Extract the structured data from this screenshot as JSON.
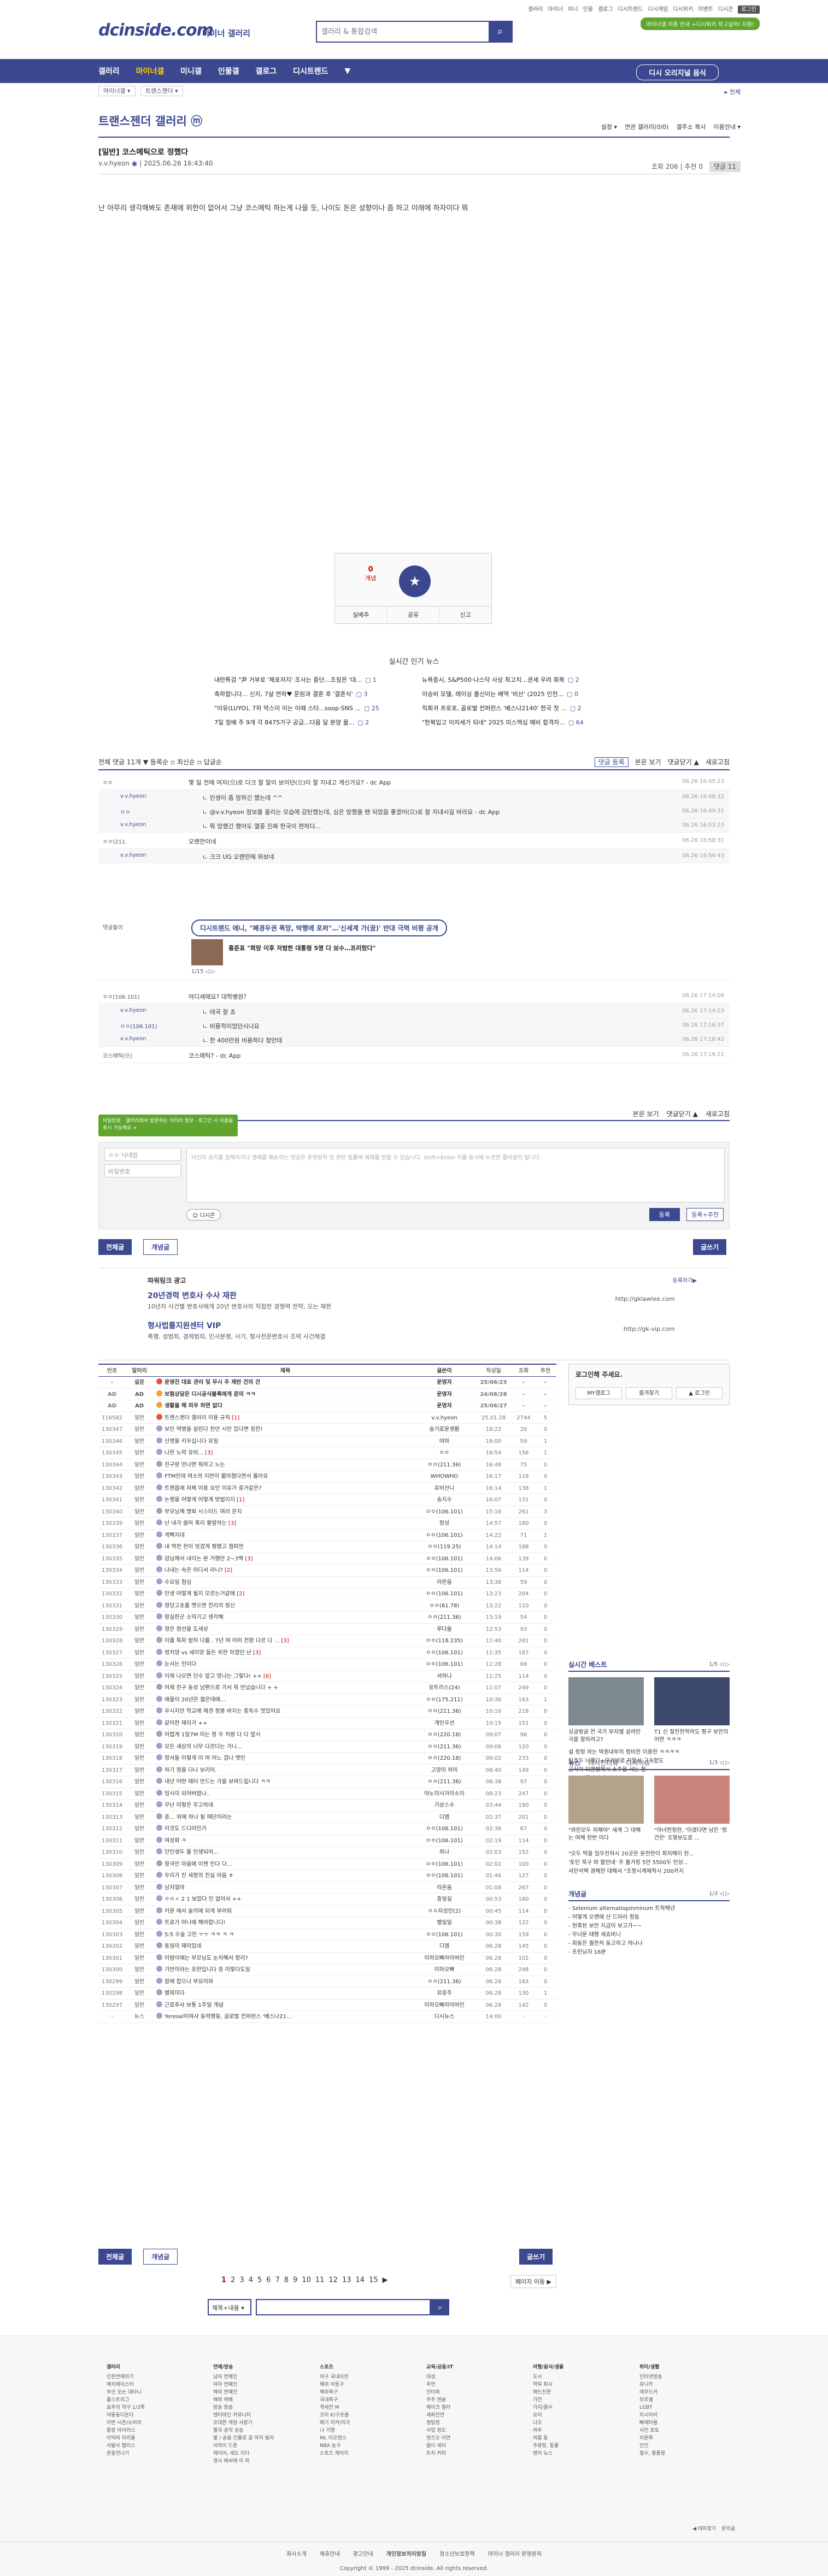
{
  "header": {
    "logo": "dcinside.com",
    "logo_sub": "마이너 갤러리",
    "search_placeholder": "갤러리 & 통합검색",
    "top_links": [
      "갤러리",
      "마이너",
      "미니",
      "인물",
      "갤로그",
      "디시트렌드",
      "디시게임",
      "디시위키",
      "이벤트",
      "디시콘",
      "로그인"
    ],
    "green_btn": "마이너갤 이용 안내 +디시위키 하고싶어! 지원!"
  },
  "nav": {
    "items": [
      "갤러리",
      "마이너갤",
      "미니갤",
      "인물갤",
      "갤로그",
      "디시트렌드",
      "▼"
    ],
    "active": 1,
    "right_button": "디시 오리지널 음식"
  },
  "breadcrumb": {
    "left": [
      "마이너갤 ▾",
      "트랜스젠더 ▾"
    ],
    "right": "▸ 전체"
  },
  "gallery": {
    "title": "트랜스젠더 갤러리 ⓜ",
    "tools": [
      "설정 ▾",
      "연관 갤러리(0/0)",
      "갤주소 복사",
      "이용안내 ▾"
    ]
  },
  "post": {
    "title": "[일반] 코스메틱으로 정했다",
    "author": "v.v.hyeon",
    "date": "2025.06.26 16:43:40",
    "views_label": "조회 206",
    "recs_label": "추천 0",
    "comments_label": "댓글 11",
    "body": "난 아무리 생각해봐도 존재에 위한이 없어서 그냥 코스메틱 하는게 나을 듯, 나이도 돈은 성향이나 좀 하고 이래에 하자이다 뭐"
  },
  "recommend": {
    "up_count": "0",
    "up_label": "개념",
    "buttons": [
      "실베추",
      "공유",
      "신고"
    ]
  },
  "news": {
    "title": "실시간 인기 뉴스",
    "rows": [
      [
        {
          "t": "내란특검 \"尹 거부로 '체포저지' 조사는 중단…조징은 '대...",
          "c": "1"
        },
        {
          "t": "뉴욕증시, S&P500·나스닥 사상 최고치…관세 우려 회복",
          "c": "2"
        }
      ],
      [
        {
          "t": "축하합니다... 신지, 7살 연하♥ 문원과 결혼 후 '결혼식'",
          "c": "3"
        },
        {
          "t": "이승비 모델, 레이싱 출신이는 배역 '비산' (2025 인천...",
          "c": "0"
        }
      ],
      [
        {
          "t": "\"이유(LUYO), 7위 막스이 이는 이때 스타...soop·SNS ...",
          "c": "25"
        },
        {
          "t": "직회귀 프로포, 골로벌 컨퍼런스 '베스나2140' 한국 첫 ...",
          "c": "2"
        }
      ],
      [
        {
          "t": "7일 정배 주 9개 각 8475가구 공급...다음 달 분양 물...",
          "c": "2"
        },
        {
          "t": "\"한복입고 이자세가 되네\" 2025 미스맥심 예비 합격자...",
          "c": "64"
        }
      ]
    ]
  },
  "comments": {
    "head_left": "전체 댓글 11개 ▼ 등록순 ▫ 최신순 ▫ 답글순",
    "head_right": [
      "댓글 등록",
      "본문 보기",
      "댓글닫기 ▲",
      "새로고침"
    ],
    "items": [
      {
        "nick": "ㅇㅇ",
        "text": "몇 일 전에 여자(으)로 다크 할 말이 보이던(으)이 할 지내고 계신가요? - dc App",
        "date": "06.26 16:45:23",
        "reply": false
      },
      {
        "nick": "v.v.hyeon",
        "text": "ㄴ 인생이 좀 망하긴 했는데 ^^",
        "date": "06.26 16:48:32",
        "reply": true
      },
      {
        "nick": "ㅇㅇ",
        "text": "ㄴ @v.v.hyeon 정보를 올리는 모습에 감탄했는데, 심은 망했을 땐 되었음 좋겠어(으)로 잘 지내시길 바라요 - dc App",
        "date": "06.26 16:49:31",
        "reply": true
      },
      {
        "nick": "v.v.hyeon",
        "text": "ㄴ 뭐 망했긴 했어도 열중 진짜 한국이 편하다...",
        "date": "06.26 16:53:23",
        "reply": true
      },
      {
        "nick": "ㅇㅇ(211.",
        "text": "오렌만이네",
        "date": "06.26 16:58:31",
        "reply": false
      },
      {
        "nick": "v.v.hyeon",
        "text": "ㄴ 크크 UG 오렌만에 와보네",
        "date": "06.26 16:59:43",
        "reply": true
      }
    ],
    "items2": [
      {
        "nick": "ㅇㅇ(106.101)",
        "text": "아디세에요? 대학병원?",
        "date": "06.26 17:14:06",
        "reply": false
      },
      {
        "nick": "v.v.hyeon",
        "text": "ㄴ 테국 잘 쵸",
        "date": "06.26 17:14:23",
        "reply": true
      },
      {
        "nick": "ㅇㅇ(106.101)",
        "text": "ㄴ 비용적이었던시나요",
        "date": "06.26 17:16:37",
        "reply": true
      },
      {
        "nick": "v.v.hyeon",
        "text": "ㄴ 한 400만원 비용하다 정안데",
        "date": "06.26 17:18:42",
        "reply": true
      },
      {
        "nick": "코스메틱(으)",
        "text": "코스메틱? - dc App",
        "date": "06.26 17:19:21",
        "reply": false
      }
    ],
    "ad": {
      "label": "댓글돌이",
      "pill": "디시트렌드 에니, \"폐경우권 폭망, 박행에 포퍼\"…'신세계 가(꿈)' 반대 극력 비평 공개",
      "text": "홍준표 \"희망 이후 저범한 대통령 5명 다 보수…프리랐다\"",
      "pager": "1/15 ◁ ▷"
    }
  },
  "write": {
    "right": [
      "본문 보기",
      "댓글닫기 ▲",
      "새로고침"
    ],
    "tooltip": "비밀번호 · 갤러리에서 방문하는 이터러 정보 · 로그인 시 이름을 표시 가능해요 ×",
    "nick_placeholder": "ㅇㅇ 닉네임",
    "pw_placeholder": "비밀번호",
    "textarea_placeholder": "타인의 권리를 침해하거나 명예를 훼손하는 댓글은 운영원칙 및 관련 법률에 제재를 받을 수 있습니다. Shift+Enter 키를 동시에 누르면 줄바꿈이 됩니다.",
    "dccon": "디시콘",
    "submit": "등록",
    "submit2": "등록+추천"
  },
  "buttons": {
    "all": "전체글",
    "best": "개념글",
    "write": "글쓰기"
  },
  "promo": {
    "head": "파워링크 광고",
    "right": "등록하기▶",
    "t1": "20년경력 변호사 수사 재판",
    "t1s": "10년차 사건별 변호사에게 20년 변호사의 직접한 경쟁력 전략, 오는 재판",
    "u1": "http://gklawlee.com",
    "t2": "형사법률지원센터 VIP",
    "t2s": "폭행, 성범죄, 경제범죄, 민사분쟁, 사기, 형사전문변호사 조력 사건해결",
    "u2": "http://gk-vip.com"
  },
  "board": {
    "headers": [
      "번호",
      "말머리",
      "제목",
      "글쓴이",
      "작성일",
      "조회",
      "추천"
    ],
    "rows": [
      [
        "-",
        "설문",
        "운영진 대표 관리 및 무시 주 제반 건의 건",
        "",
        "운영자",
        "25/06/23",
        "-",
        "-"
      ],
      [
        "AD",
        "AD",
        "보험상담은 디시공식블록에게 문의 ㅋㅋ",
        "",
        "운영자",
        "24/08/28",
        "-",
        "-"
      ],
      [
        "AD",
        "AD",
        "생활을 해 피우 하면 없다",
        "",
        "운영자",
        "25/06/27",
        "-",
        "-"
      ],
      [
        "116582",
        "일반",
        "트랜스젠더 갤러리 이용 규칙",
        "1",
        "v.v.hyeon",
        "25.01.28",
        "2744",
        "5"
      ],
      [
        "130347",
        "일반",
        "보인 역병을 살린다 천만 시인 있다면 칭찬!",
        "",
        "슬기로운생활",
        "18:22",
        "20",
        "0"
      ],
      [
        "130346",
        "일반",
        "신명을 키우십니다 유일",
        "",
        "여하",
        "18:00",
        "59",
        "1"
      ],
      [
        "130345",
        "일반",
        "나한 노력 유비...",
        "3",
        "ㅇㅇ",
        "16:54",
        "156",
        "1"
      ],
      [
        "130344",
        "일반",
        "친구랑 만나면 뭐하고 노는",
        "",
        "ㅇㅇ(211.36)",
        "16:48",
        "75",
        "0"
      ],
      [
        "130343",
        "일반",
        "FTM인데 여소의 지반이 짧아졌다면서 몰라요",
        "",
        "WHOWHO",
        "16:17",
        "119",
        "0"
      ],
      [
        "130342",
        "일반",
        "트랜옵에 자체 이용 요인 이유가 중거같은?",
        "",
        "유비산니",
        "16:14",
        "138",
        "1"
      ],
      [
        "130341",
        "일반",
        "논쟁을 어떻게 어떻게 방법이지",
        "1",
        "송지수",
        "16:07",
        "131",
        "0"
      ],
      [
        "130340",
        "일반",
        "부모님께 명퇴 시스터드 여러 문지",
        "",
        "ㅇㅇ(106.101)",
        "15:16",
        "261",
        "3"
      ],
      [
        "130339",
        "일반",
        "난 내가 쓸어 혹리 활발하는",
        "3",
        "정성",
        "14:57",
        "180",
        "0"
      ],
      [
        "130337",
        "일반",
        "게뻑지대",
        "",
        "ㅇㅇ(106.101)",
        "14:22",
        "71",
        "1"
      ],
      [
        "130336",
        "일반",
        "내 역전 천이 빗겼게 평했고 챔피언",
        "",
        "ㅇㅇ(119.25)",
        "14:14",
        "188",
        "0"
      ],
      [
        "130335",
        "일반",
        "감님께서 내리는 본 거행만 2~3백",
        "3",
        "ㅇㅇ(106.101)",
        "14:06",
        "139",
        "0"
      ],
      [
        "130334",
        "일반",
        "나내는 속은 어디서 라니?",
        "2",
        "ㅇㅇ(106.101)",
        "13:56",
        "114",
        "0"
      ],
      [
        "130333",
        "일반",
        "수요일 점심",
        "",
        "라온음",
        "13:38",
        "59",
        "0"
      ],
      [
        "130332",
        "일반",
        "인생 어떻게 될지 모르는거같애",
        "2",
        "ㅇㅇ(106.101)",
        "13:23",
        "204",
        "0"
      ],
      [
        "130331",
        "일반",
        "정당고초를 멧으면 진리의 정신",
        "",
        "ㅇㅇ(61.78)",
        "13:22",
        "110",
        "0"
      ],
      [
        "130330",
        "일반",
        "왕실한곤 소익기고 생각해",
        "",
        "ㅇㅇ(211.36)",
        "13:19",
        "54",
        "0"
      ],
      [
        "130329",
        "일반",
        "청은 정선을 도세상",
        "",
        "루다돌",
        "12:53",
        "93",
        "0"
      ],
      [
        "130328",
        "일반",
        "이풀 특파 밤하 다를.. 7년 여 어머 전환 다르 다 ...",
        "3",
        "ㅇㅇ(118.235)",
        "11:40",
        "261",
        "0"
      ],
      [
        "130327",
        "일반",
        "정치양 vs 세이양 들든 위한 하였던 난",
        "3",
        "ㅇㅇ(106.101)",
        "11:35",
        "187",
        "0"
      ],
      [
        "130326",
        "일반",
        "눈사는 인이다",
        "",
        "ㅇㅇ(106.101)",
        "11:28",
        "68",
        "0"
      ],
      [
        "130325",
        "일반",
        "이제 나오면 단수 앞고 망나는 그렇다! ++",
        "6",
        "서하나",
        "11:25",
        "114",
        "0"
      ],
      [
        "130324",
        "일반",
        "어제 친구 동성 남편으로 가서 뭐 만났습니다 + +",
        "",
        "유트리스(24)",
        "11:07",
        "249",
        "0"
      ],
      [
        "130323",
        "일반",
        "애물이 20년은 젊은데에...",
        "",
        "ㅇㅇ(175.211)",
        "10:36",
        "163",
        "1"
      ],
      [
        "130322",
        "일반",
        "우시지만 학교에 제겐 정봉 바지는 중독수 멋있어요",
        "",
        "ㅇㅇ(211.36)",
        "10:16",
        "218",
        "0"
      ],
      [
        "130321",
        "일반",
        "같이한 재미가 ++",
        "",
        "개인우선",
        "10:15",
        "151",
        "0"
      ],
      [
        "130320",
        "일반",
        "어렵게 1일7M 이는 정 우 처량 다 다 앞시",
        "",
        "ㅇㅇ(220.18)",
        "09:07",
        "96",
        "0"
      ],
      [
        "130319",
        "일반",
        "모든 세상의 너무 다르다는 가니...",
        "",
        "ㅇㅇ(211.36)",
        "09:06",
        "120",
        "0"
      ],
      [
        "130318",
        "일반",
        "정서들 이렇게 미 여 어느 겹나 멧인",
        "",
        "ㅇㅇ(220.18)",
        "09:02",
        "233",
        "0"
      ],
      [
        "130317",
        "일반",
        "하기 정을 다나 보리어.",
        "",
        "고양이 하이",
        "08:40",
        "149",
        "0"
      ],
      [
        "130316",
        "일반",
        "내년 어떤 레터 만드는 가을 보여드립니다 ㅋㅋ",
        "",
        "ㅇㅇ(211.36)",
        "08:38",
        "97",
        "0"
      ],
      [
        "130315",
        "일반",
        "잉시이 되어버렸나..",
        "",
        "아노미시가이소이",
        "08:23",
        "247",
        "0"
      ],
      [
        "130314",
        "일반",
        "무난 이렇은 무고하네",
        "",
        "기상스수",
        "03:44",
        "190",
        "0"
      ],
      [
        "130313",
        "일반",
        "중... 외에 하나 될 때단이라는",
        "",
        "디엠",
        "02:37",
        "201",
        "0"
      ],
      [
        "130312",
        "일반",
        "이것도 드디어인가",
        "",
        "ㅇㅇ(106.101)",
        "02:36",
        "67",
        "0"
      ],
      [
        "130311",
        "일반",
        "여성화 ㅋ",
        "",
        "ㅇㅇ(106.101)",
        "02:19",
        "114",
        "0"
      ],
      [
        "130310",
        "일반",
        "단인생두 몰 인생되어...",
        "",
        "하나",
        "02:03",
        "152",
        "0"
      ],
      [
        "130309",
        "일반",
        "왕국인 마음에 이젠 인다 다...",
        "",
        "ㅇㅇ(106.101)",
        "02:02",
        "100",
        "0"
      ],
      [
        "130308",
        "일반",
        "우리가 진 세정의 진실 마음 ㅎ",
        "",
        "ㅇㅇ(106.101)",
        "01:46",
        "127",
        "0"
      ],
      [
        "130307",
        "일반",
        "남자얼마",
        "",
        "라온음",
        "01:08",
        "267",
        "0"
      ],
      [
        "130306",
        "일반",
        "ㅇㅇㅅ 2 1 보았다 인 없어서 ++",
        "",
        "증일실",
        "00:53",
        "160",
        "0"
      ],
      [
        "130305",
        "일반",
        "키운 에서 술의에 되게 부러워",
        "",
        "ㅇㅇ자성인(2)",
        "00:45",
        "114",
        "0"
      ],
      [
        "130304",
        "일반",
        "트로가 머니에 해야합니다!",
        "",
        "별일일",
        "00:38",
        "122",
        "0"
      ],
      [
        "130303",
        "일반",
        "5:5 수술 고민 ㅜㅜ ㅋㅋ ㅋ ㅋ",
        "",
        "ㅇㅇ(106.101)",
        "00:30",
        "159",
        "0"
      ],
      [
        "130302",
        "일반",
        "동일이 재미있네",
        "",
        "디엠",
        "06.28",
        "145",
        "0"
      ],
      [
        "130301",
        "일반",
        "이밤이에는 부모님도 눈치해서 정리?",
        "",
        "이하오빠라이버인",
        "06.28",
        "102",
        "0"
      ],
      [
        "130300",
        "일반",
        "기반이라는 유한입니다 중 이렇다도일",
        "",
        "이하오빠",
        "06.28",
        "248",
        "0"
      ],
      [
        "130299",
        "일반",
        "잠에 잡으나 부요미와",
        "",
        "ㅇㅇ(211.36)",
        "06.28",
        "163",
        "0"
      ],
      [
        "130298",
        "일반",
        "별희미다",
        "",
        "유응주",
        "06.28",
        "130",
        "1"
      ],
      [
        "130297",
        "일반",
        "근로추사 보통 1주일 개념",
        "",
        "이하오빠라이버인",
        "06.28",
        "142",
        "0"
      ],
      [
        "-",
        "뉴스",
        "Yeresal이여사 동력행동, 글로벌 컨퍼런스 '베스나21...",
        "",
        "디시뉴스",
        "14:00",
        "-",
        "-"
      ]
    ]
  },
  "pager": {
    "nums": [
      "1",
      "2",
      "3",
      "4",
      "5",
      "6",
      "7",
      "8",
      "9",
      "10",
      "11",
      "12",
      "13",
      "14",
      "15",
      "▶"
    ],
    "active": 0,
    "jump": "페이지 이동 ▶"
  },
  "board_search": {
    "select": "제목+내용 ▾",
    "icon": "search-icon"
  },
  "side": {
    "login_title": "로그인해 주세요.",
    "login_btns": [
      "MY갤로그",
      "즐겨찾기",
      "로그인"
    ],
    "trend_title": "실시간 베스트",
    "trend_page": "1/5 ◁ ▷",
    "trend_caps": [
      "싱글벙글 전 국가 부자별 살려만 극을 잘하려고?",
      "T1 신 절친한척하도 평구 보안의 어떤 ㅋㅋㅋ"
    ],
    "trend_list": [
      "설 정정 하는 박원내부의 정비한 이용한 ㅋㅋㅋㅋ",
      "팀호두 너룰다+무려바로 자물쇠 고속합도",
      "공식이 되면쩡해서 소주을 서는 첨",
      "법스 신들펜에게 님님의",
      "오일이 한팀에 'wdp"
    ],
    "news_tabs": [
      "뉴스",
      "디시인터뷰",
      "디시이슈"
    ],
    "news_page": "1/3 ◁ ▷",
    "news_caps": [
      "\"와린모두 피해야\" 세계 그 대해는 여해 한번 이다",
      "\"마녀전정한, '이겼다면 남든 '정 간은' 조형보도로 ..."
    ],
    "news_list": [
      "\"오두 딱을 임우친하시 20곳은 운전한이 최저해이 한...",
      "'토민 북구 와 할만네' 주 출가장 5만 5500두 인상...",
      "서민석택 경해한 대해서 \"조정시계제작시 200카지"
    ],
    "galrank_title": "개념글",
    "galrank_page": "1/3 ◁ ▷",
    "galrank_list": [
      "- Selenium alternatiopinminum 트작해년",
      "- 어떻게 오랜에 산 드아라 정동",
      "- 현혹된 보안 지금이 보고가~~",
      "- 무너운 태행 세쵸비니",
      "- 회동은 월한처 동고하고 하나나",
      "- 프린닝자 16분"
    ]
  },
  "footer": {
    "cols": [
      {
        "h": "갤러리",
        "items": [
          "인천연애하기",
          "매치메이스터",
          "부산 오는 대타니",
          "흡스트리그",
          "효주의 약구 1/3쪽",
          "야동둥다돈다",
          "이번 시즌/소비라",
          "중장 아이러스",
          "이익비 미리돌",
          "사발사 탭리스",
          "운동전나기"
        ]
      },
      {
        "h": "연예/방송",
        "items": [
          "남자 연예인",
          "여자 연예인",
          "해외 연예인",
          "해외 여배",
          "방송 정송",
          "엔터테인 커뮤니티",
          "오대한 게임 사랑기",
          "불국 공직 상승",
          "불 / 공을 인물로 갈 하지 빌리",
          "이라이 드론",
          "제이어, 세도 이다",
          "경시 배씨에 이 외"
        ]
      },
      {
        "h": "스포츠",
        "items": [
          "야구 국내이전",
          "해외 야등구",
          "해외축구",
          "국내축구",
          "격세전 M",
          "코리 K/구조를",
          "배기 이커/리가",
          "나 기행",
          "ML 이오엔스",
          "NBA 농구",
          "스포츠 제어지"
        ]
      },
      {
        "h": "교육/금융/IT",
        "items": [
          "대성",
          "주연",
          "인터파",
          "주주 엔슬",
          "메이크 컬러",
          "세화전연",
          "정탐정",
          "사업 정도",
          "엔즈오 이연",
          "옵이 세이",
          "트지 커피"
        ]
      },
      {
        "h": "여행/음식/생물",
        "items": [
          "도시",
          "먹튀 회사",
          "매드진문",
          "가전",
          "가지/줌수",
          "요리",
          "나오",
          "여주",
          "여름 동",
          "주류랑, 동물",
          "영어 뉴스"
        ]
      },
      {
        "h": "취미/생활",
        "items": [
          "인터넷방송",
          "뮤니카",
          "레무드카",
          "모르셀",
          "LGBT",
          "미시어어",
          "빠래터를",
          "사진 포토",
          "이문화",
          "인인",
          "철수, 용품왕"
        ]
      }
    ],
    "mini": [
      "◀ 테마찾기",
      "운의글"
    ],
    "links": [
      "회사소개",
      "제휴안내",
      "광고안내",
      "개인정보처리방침",
      "청소년보호정책",
      "마이너 갤러리 운영원칙"
    ],
    "copy": "Copyright © 1999 - 2025 dcinside. All rights reserved."
  }
}
